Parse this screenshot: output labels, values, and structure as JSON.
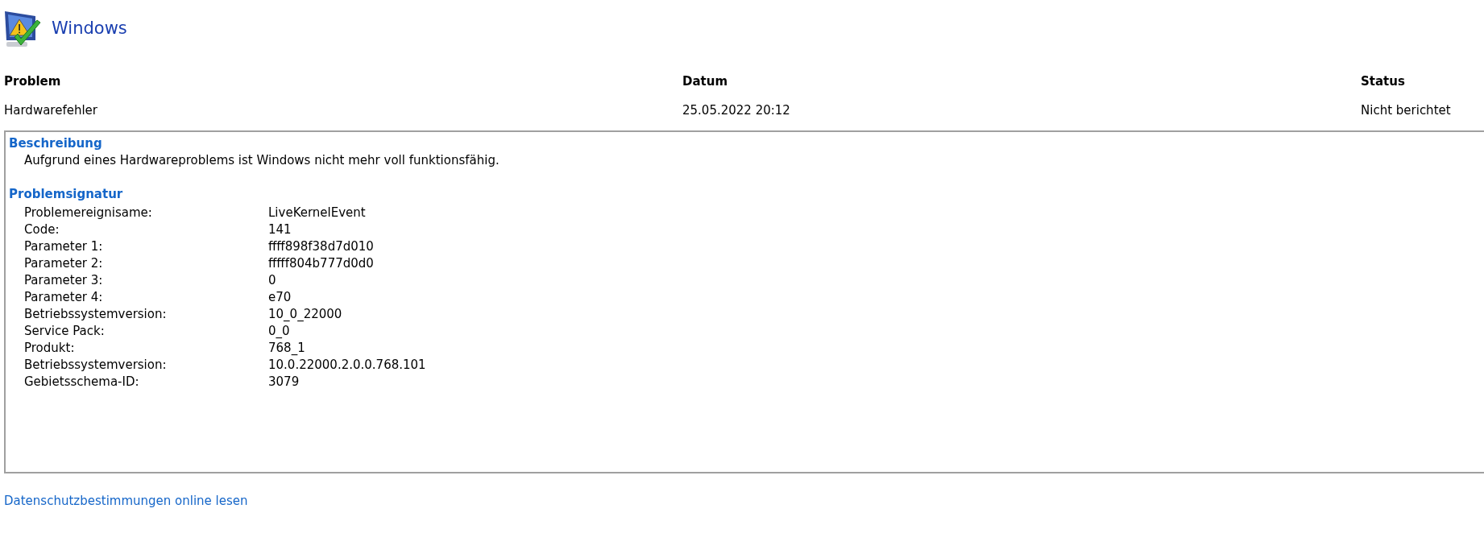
{
  "header": {
    "title": "Windows"
  },
  "columns": [
    {
      "label": "Problem"
    },
    {
      "label": "Datum"
    },
    {
      "label": "Status"
    }
  ],
  "row": [
    "Hardwarefehler",
    "25.05.2022 20:12",
    "Nicht berichtet"
  ],
  "details": {
    "description_heading": "Beschreibung",
    "description": "Aufgrund eines Hardwareproblems ist Windows nicht mehr voll funktionsfähig.",
    "signature_heading": "Problemsignatur",
    "signature": [
      {
        "label": "Problemereignisame:",
        "value": "LiveKernelEvent"
      },
      {
        "label": "Code:",
        "value": "141"
      },
      {
        "label": "Parameter 1:",
        "value": "ffff898f38d7d010"
      },
      {
        "label": "Parameter 2:",
        "value": "fffff804b777d0d0"
      },
      {
        "label": "Parameter 3:",
        "value": "0"
      },
      {
        "label": "Parameter 4:",
        "value": "e70"
      },
      {
        "label": "Betriebssystemversion:",
        "value": "10_0_22000"
      },
      {
        "label": "Service Pack:",
        "value": "0_0"
      },
      {
        "label": "Produkt:",
        "value": "768_1"
      },
      {
        "label": "Betriebssystemversion:",
        "value": "10.0.22000.2.0.0.768.101"
      },
      {
        "label": "Gebietsschema-ID:",
        "value": "3079"
      }
    ]
  },
  "privacy_link": "Datenschutzbestimmungen online lesen"
}
